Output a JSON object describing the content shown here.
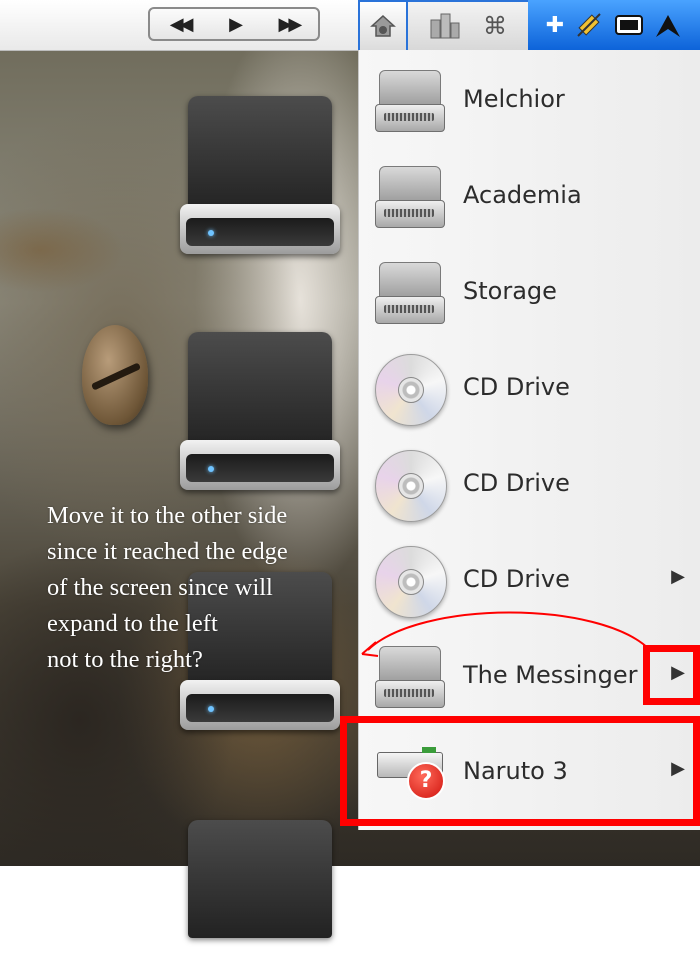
{
  "media_controls": {
    "rewind": "◀◀",
    "play": "▶",
    "fastforward": "▶▶"
  },
  "top_tabs": {
    "home_icon": "home-icon",
    "apps_icon": "buildings-icon",
    "command_icon": "command-icon",
    "command_glyph": "⌘",
    "right_icons": [
      "plus-icon",
      "satellite-icon",
      "display-icon",
      "peak-icon"
    ]
  },
  "menu": {
    "items": [
      {
        "label": "Melchior",
        "icon": "hard-drive-icon",
        "submenu": false
      },
      {
        "label": "Academia",
        "icon": "hard-drive-icon",
        "submenu": false
      },
      {
        "label": "Storage",
        "icon": "hard-drive-icon",
        "submenu": false
      },
      {
        "label": "CD Drive",
        "icon": "cd-drive-icon",
        "submenu": false
      },
      {
        "label": "CD Drive",
        "icon": "cd-drive-icon",
        "submenu": false
      },
      {
        "label": "CD Drive",
        "icon": "cd-drive-icon",
        "submenu": true
      },
      {
        "label": "The Messinger",
        "icon": "hard-drive-icon",
        "submenu": true
      },
      {
        "label": "Naruto 3",
        "icon": "external-drive-unknown-icon",
        "submenu": true
      }
    ],
    "submenu_arrow": "▶"
  },
  "annotation": {
    "lines": [
      "Move it to the other side",
      "since it reached the edge",
      "of the screen since will",
      "expand to the left",
      "not to the right?"
    ]
  },
  "colors": {
    "highlight": "#ff0000",
    "accent_blue": "#1f7ae0"
  }
}
